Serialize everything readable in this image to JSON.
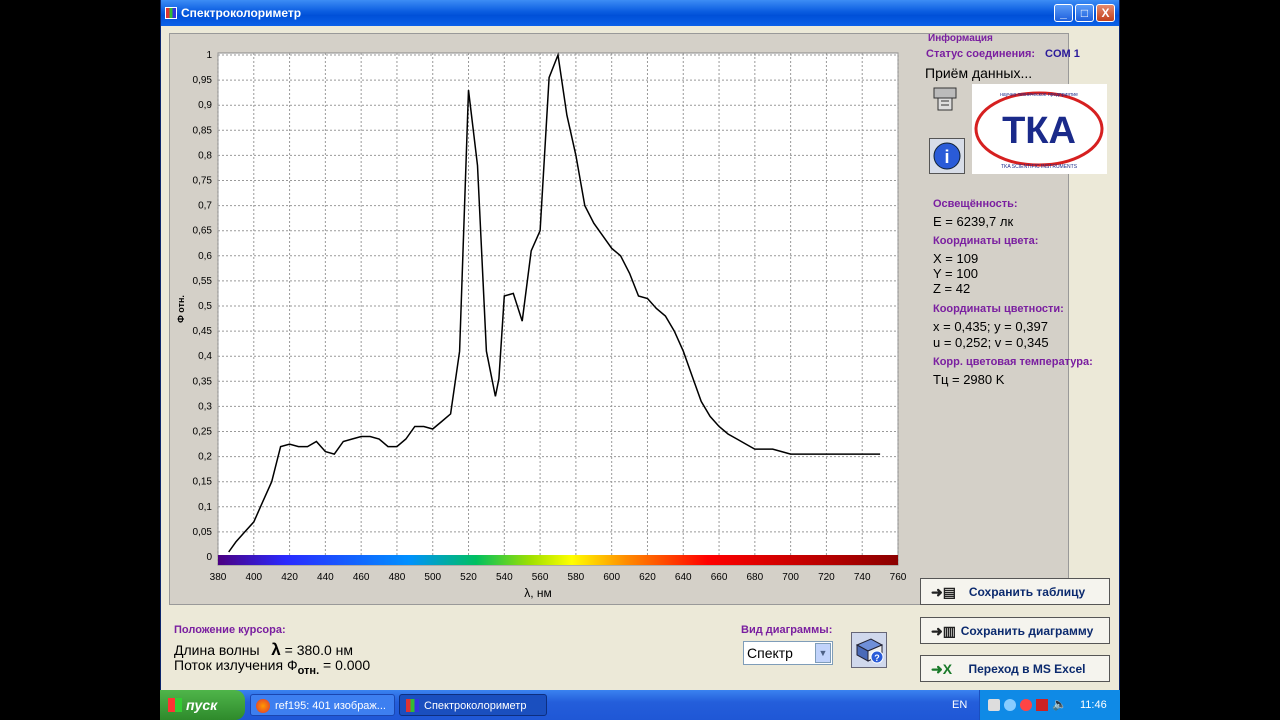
{
  "window": {
    "title": "Спектроколориметр"
  },
  "titlebar_buttons": {
    "minimize": "_",
    "maximize": "□",
    "close": "X"
  },
  "chart_data": {
    "type": "line",
    "xlabel": "λ, нм",
    "ylabel": "Ф отн.",
    "xlim": [
      380,
      760
    ],
    "ylim": [
      0,
      1
    ],
    "x_ticks": [
      380,
      400,
      420,
      440,
      460,
      480,
      500,
      520,
      540,
      560,
      580,
      600,
      620,
      640,
      660,
      680,
      700,
      720,
      740,
      760
    ],
    "y_ticks": [
      "0",
      "0,05",
      "0,1",
      "0,15",
      "0,2",
      "0,25",
      "0,3",
      "0,35",
      "0,4",
      "0,45",
      "0,5",
      "0,55",
      "0,6",
      "0,65",
      "0,7",
      "0,75",
      "0,8",
      "0,85",
      "0,9",
      "0,95",
      "1"
    ],
    "grid": true,
    "series": [
      {
        "color": "#000000",
        "x": [
          386,
          390,
          395,
          400,
          405,
          410,
          415,
          420,
          425,
          430,
          435,
          440,
          445,
          450,
          455,
          460,
          465,
          470,
          475,
          480,
          485,
          490,
          495,
          500,
          505,
          510,
          515,
          520,
          525,
          530,
          535,
          537,
          540,
          545,
          550,
          555,
          560,
          565,
          570,
          575,
          580,
          585,
          590,
          595,
          600,
          605,
          610,
          615,
          620,
          625,
          630,
          635,
          640,
          645,
          650,
          655,
          660,
          665,
          670,
          675,
          680,
          685,
          690,
          695,
          700,
          705,
          710,
          715,
          720,
          725,
          730,
          735,
          740,
          745,
          750
        ],
        "y": [
          0.01,
          0.03,
          0.05,
          0.07,
          0.11,
          0.15,
          0.22,
          0.225,
          0.22,
          0.22,
          0.23,
          0.21,
          0.205,
          0.23,
          0.235,
          0.24,
          0.24,
          0.235,
          0.22,
          0.22,
          0.235,
          0.26,
          0.26,
          0.255,
          0.27,
          0.285,
          0.41,
          0.93,
          0.78,
          0.41,
          0.32,
          0.355,
          0.52,
          0.525,
          0.47,
          0.61,
          0.65,
          0.955,
          1.0,
          0.88,
          0.8,
          0.7,
          0.665,
          0.64,
          0.615,
          0.6,
          0.565,
          0.52,
          0.515,
          0.495,
          0.48,
          0.45,
          0.41,
          0.36,
          0.31,
          0.28,
          0.26,
          0.245,
          0.235,
          0.225,
          0.215,
          0.215,
          0.215,
          0.21,
          0.205,
          0.205,
          0.205,
          0.205,
          0.205,
          0.205,
          0.205,
          0.205,
          0.205,
          0.205,
          0.205
        ]
      }
    ]
  },
  "info": {
    "section_title": "Информация",
    "status_label": "Статус соединения:",
    "status_value": "COM 1",
    "receiving": "Приём данных...",
    "illuminance_label": "Освещённость:",
    "illuminance_value": "E = 6239,7 лк",
    "color_coords_label": "Координаты цвета:",
    "X": "X = 109",
    "Y": "Y = 100",
    "Z": "Z = 42",
    "chroma_label": "Координаты цветности:",
    "xy": "x = 0,435;  y = 0,397",
    "uv": "u = 0,252;  v = 0,345",
    "cct_label": "Корр. цветовая температура:",
    "cct_value": "Tц = 2980 K",
    "logo_text": "ТКА",
    "logo_top": "научно-техническое предприятие",
    "logo_bottom": "TKA SCIENTIFIC INSTRUMENTS"
  },
  "cursor": {
    "title": "Положение курсора:",
    "wavelength_label": "Длина волны",
    "wavelength_symbol": "λ",
    "wavelength_value": "= 380.0 нм",
    "flux_label": "Поток излучения Ф",
    "flux_sub": "отн.",
    "flux_value": "= 0.000"
  },
  "diagram": {
    "label": "Вид диаграммы:",
    "selected": "Спектр"
  },
  "buttons": {
    "save_table": "Сохранить таблицу",
    "save_diagram": "Сохранить диаграмму",
    "excel": "Переход в MS Excel"
  },
  "taskbar": {
    "start": "пуск",
    "task1": "ref195: 401 изображ...",
    "task2": "Спектроколориметр",
    "lang": "EN",
    "time": "11:46"
  },
  "colors": {
    "accent": "#7a1fa0",
    "titlebar": "#0a5ce0"
  }
}
